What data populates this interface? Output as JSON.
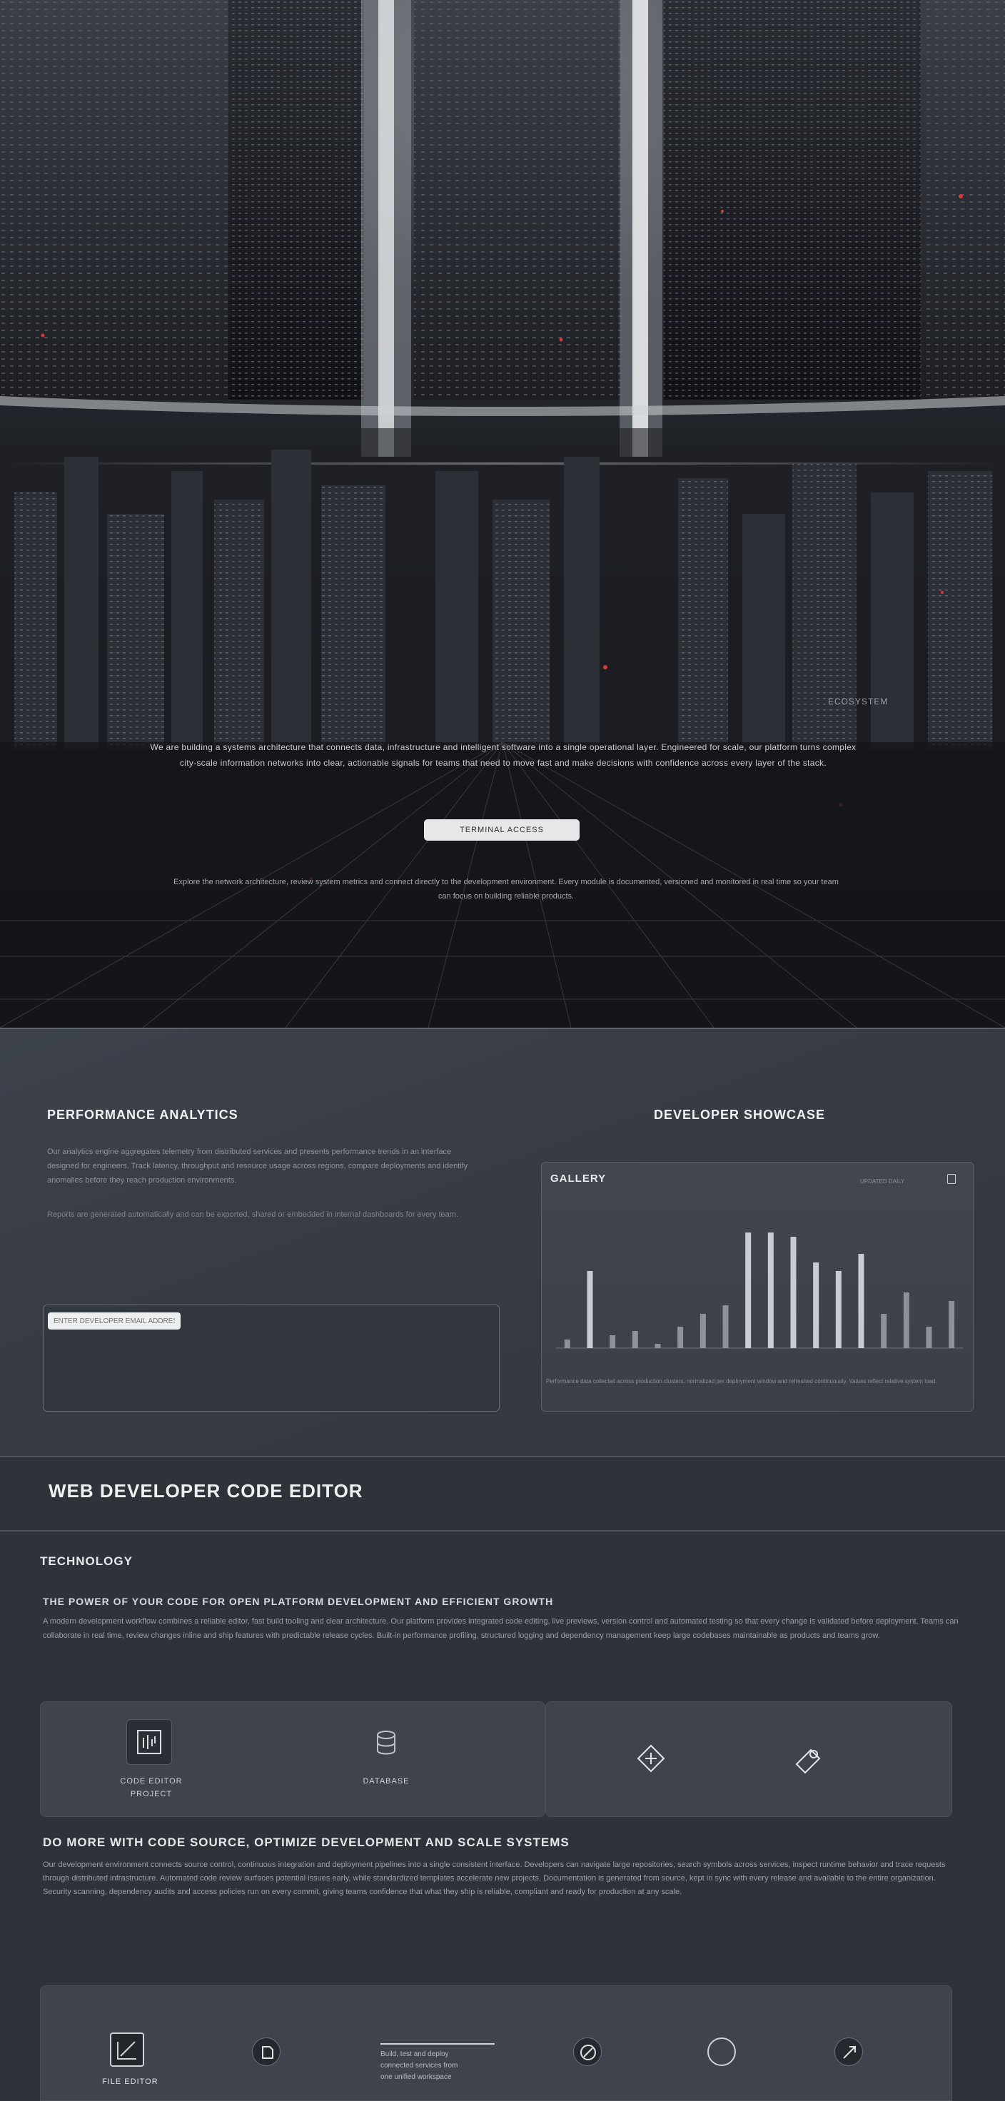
{
  "hero": {
    "tag": "ECOSYSTEM",
    "text": "We are building a systems architecture that connects data, infrastructure and intelligent software into a single operational layer. Engineered for scale, our platform turns complex city-scale information networks into clear, actionable signals for teams that need to move fast and make decisions with confidence across every layer of the stack.",
    "button_label": "TERMINAL ACCESS",
    "sub_text": "Explore the network architecture, review system metrics and connect directly to the development environment. Every module is documented, versioned and monitored in real time so your team can focus on building reliable products."
  },
  "section_analytics": {
    "title_left": "PERFORMANCE ANALYTICS",
    "title_right": "DEVELOPER SHOWCASE",
    "paragraph": "Our analytics engine aggregates telemetry from distributed services and presents performance trends in an interface designed for engineers. Track latency, throughput and resource usage across regions, compare deployments and identify anomalies before they reach production environments.",
    "paragraph_2": "Reports are generated automatically and can be exported, shared or embedded in internal dashboards for every team.",
    "input_placeholder": "ENTER DEVELOPER EMAIL ADDRESS",
    "chart_title": "GALLERY",
    "chart_meta": "UPDATED DAILY",
    "chart_caption": "Performance data collected across production clusters, normalized per deployment window and refreshed continuously. Values reflect relative system load."
  },
  "chart_data": {
    "type": "bar",
    "title": "GALLERY",
    "xlabel": "",
    "ylabel": "",
    "values": [
      2,
      18,
      3,
      4,
      1,
      5,
      8,
      10,
      27,
      27,
      26,
      20,
      18,
      22,
      8,
      13,
      5,
      11
    ],
    "ylim": [
      0,
      30
    ]
  },
  "section_web": {
    "title": "WEB DEVELOPER CODE EDITOR",
    "heading": "TECHNOLOGY",
    "lead": "THE POWER OF YOUR CODE FOR OPEN PLATFORM DEVELOPMENT AND EFFICIENT GROWTH",
    "paragraph": "A modern development workflow combines a reliable editor, fast build tooling and clear architecture. Our platform provides integrated code editing, live previews, version control and automated testing so that every change is validated before deployment. Teams can collaborate in real time, review changes inline and ship features with predictable release cycles. Built-in performance profiling, structured logging and dependency management keep large codebases maintainable as products and teams grow.",
    "cards": [
      {
        "label": "CODE EDITOR\nPROJECT"
      },
      {
        "label": "DATABASE"
      },
      {
        "label": ""
      },
      {
        "label": ""
      }
    ],
    "heading_2": "DO MORE WITH CODE SOURCE, OPTIMIZE DEVELOPMENT AND SCALE SYSTEMS",
    "paragraph_2": "Our development environment connects source control, continuous integration and deployment pipelines into a single consistent interface. Developers can navigate large repositories, search symbols across services, inspect runtime behavior and trace requests through distributed infrastructure. Automated code review surfaces potential issues early, while standardized templates accelerate new projects. Documentation is generated from source, kept in sync with every release and available to the entire organization. Security scanning, dependency audits and access policies run on every commit, giving teams confidence that what they ship is reliable, compliant and ready for production at any scale.",
    "bottom": {
      "item1_label": "FILE EDITOR",
      "text_block": "Build, test and deploy\nconnected services from\none unified workspace"
    }
  }
}
